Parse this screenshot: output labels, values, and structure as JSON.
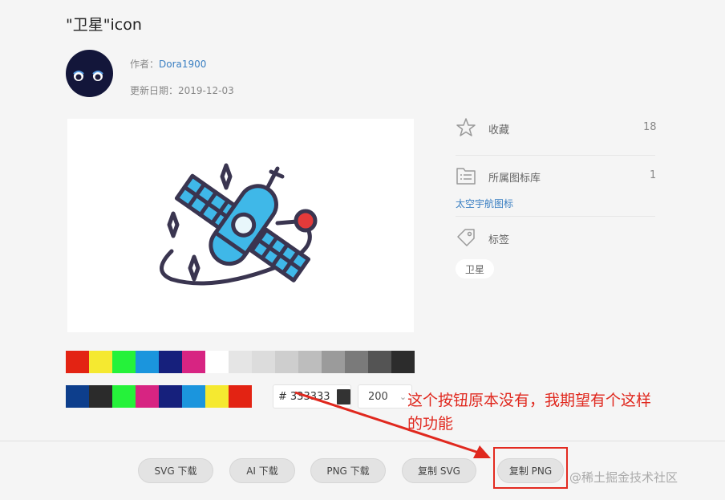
{
  "page": {
    "title": "\"卫星\"icon",
    "author_label": "作者：",
    "author_name": "Dora1900",
    "updated_label": "更新日期：",
    "updated_date": "2019-12-03"
  },
  "side": {
    "favorite_label": "收藏",
    "favorite_count": "18",
    "library_label": "所属图标库",
    "library_count": "1",
    "library_link": "太空宇航图标",
    "tags_label": "标签",
    "tag_value": "卫星"
  },
  "palette": {
    "row1": [
      "#e32313",
      "#f5e930",
      "#25f23a",
      "#1b95dd",
      "#16207c",
      "#d72482",
      "#ffffff",
      "#e5e5e5",
      "#dcdcdc",
      "#cecece",
      "#bdbdbd",
      "#9b9b9b",
      "#7a7a7a",
      "#545454",
      "#2c2c2c"
    ],
    "row2": [
      "#0d3e8c",
      "#2b2b2b",
      "#25f23a",
      "#d72482",
      "#16207c",
      "#1b95dd",
      "#f5e930",
      "#e32313"
    ]
  },
  "color_picker": {
    "hash": "#",
    "value": "333333",
    "size_value": "200",
    "size_chevron": "⌄"
  },
  "annotation": {
    "line1": "这个按钮原本没有，我期望有个这样",
    "line2": "的功能"
  },
  "buttons": {
    "svg_download": "SVG 下载",
    "ai_download": "AI 下载",
    "png_download": "PNG 下载",
    "copy_svg": "复制 SVG",
    "copy_png": "复制 PNG"
  },
  "watermark": "@稀土掘金技术社区"
}
